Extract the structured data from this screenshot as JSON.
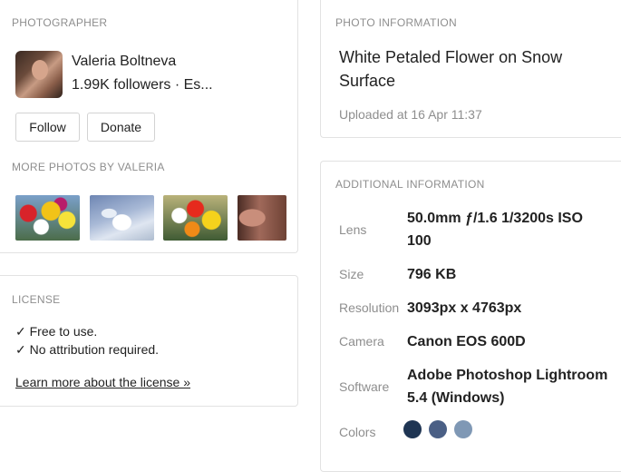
{
  "photographer": {
    "section_title": "PHOTOGRAPHER",
    "name": "Valeria Boltneva",
    "subtitle": "1.99K followers · Es...",
    "follow_label": "Follow",
    "donate_label": "Donate",
    "more_title": "MORE PHOTOS BY VALERIA"
  },
  "license": {
    "section_title": "LICENSE",
    "line1": "✓ Free to use.",
    "line2": "✓ No attribution required.",
    "link": "Learn more about the license »"
  },
  "photo_info": {
    "section_title": "PHOTO INFORMATION",
    "title": "White Petaled Flower on Snow Surface",
    "uploaded": "Uploaded at 16 Apr 11:37"
  },
  "additional": {
    "section_title": "ADDITIONAL INFORMATION",
    "lens_label": "Lens",
    "lens_value": "50.0mm ƒ/1.6 1/3200s ISO 100",
    "size_label": "Size",
    "size_value": "796 KB",
    "resolution_label": "Resolution",
    "resolution_value": "3093px x 4763px",
    "camera_label": "Camera",
    "camera_value": "Canon EOS 600D",
    "software_label": "Software",
    "software_value": "Adobe Photoshop Lightroom 5.4 (Windows)",
    "colors_label": "Colors",
    "colors": [
      "#1f3553",
      "#4a5f85",
      "#7f98b5"
    ]
  }
}
